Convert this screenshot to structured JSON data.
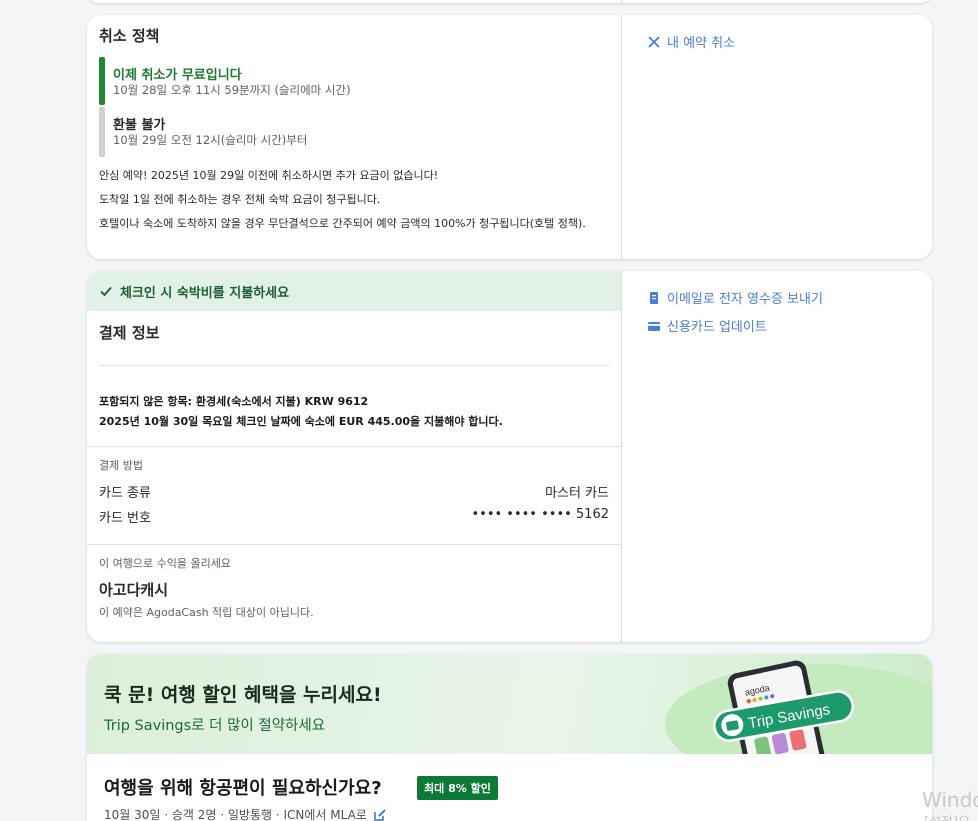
{
  "cancel": {
    "title": "취소 정책",
    "free_title": "이제 취소가 무료입니다",
    "free_deadline": "10월 28일 오후 11시 59분까지 (슬리에마 시간)",
    "nonrefund_title": "환불 불가",
    "nonrefund_from": "10월 29일 오전 12시(슬리마 시간)부터",
    "note1": "안심 예약! 2025년 10월 29일 이전에 취소하시면 추가 요금이 없습니다!",
    "note2": "도착일 1일 전에 취소하는 경우 전체 숙박 요금이 청구됩니다.",
    "note3": "호텔이나 숙소에 도착하지 않을 경우 무단결석으로 간주되어 예약 금액의 100%가 청구됩니다(호텔 정책).",
    "cancel_link": "내 예약 취소",
    "colors": {
      "free": "#1f8a35",
      "nonrefund": "#cfd1d5"
    }
  },
  "payment": {
    "banner": "체크인 시 숙박비를 지불하세요",
    "title": "결제 정보",
    "not_included": "포함되지 않은 항목: 환경세(숙소에서 지불) KRW 9612",
    "pay_at_checkin": "2025년 10월 30일 목요일 체크인 날짜에 숙소에 EUR 445.00을 지불해야 합니다.",
    "method_label": "결제 방법",
    "card_type_label": "카드 종류",
    "card_type_value": "마스터 카드",
    "card_number_label": "카드 번호",
    "card_number_value": "•••• •••• •••• 5162",
    "earn_label": "이 여행으로 수익을 올리세요",
    "cash_title": "아고다캐시",
    "cash_note": "이 예약은 AgodaCash 적립 대상이 아닙니다.",
    "email_link": "이메일로 전자 영수증 보내기",
    "card_update_link": "신용카드 업데이트"
  },
  "promo": {
    "title": "쿡 문! 여행 할인 혜택을 누리세요!",
    "subtitle": "Trip Savings로 더 많이 절약하세요",
    "phone_brand": "agoda",
    "pill_text": "Trip Savings",
    "flight_title": "여행을 위해 항공편이 필요하신가요?",
    "badge": "최대 8% 할인",
    "flight_sub": "10월 30일 · 승객 2명 · 일방통행 · ICN에서 MLA로"
  },
  "watermark": {
    "line1": "Windo",
    "line2": "[설정]으"
  },
  "colors": {
    "link": "#4a7fd9",
    "accent_green": "#0a7a34",
    "banner_bg": "#e2f1e6"
  }
}
